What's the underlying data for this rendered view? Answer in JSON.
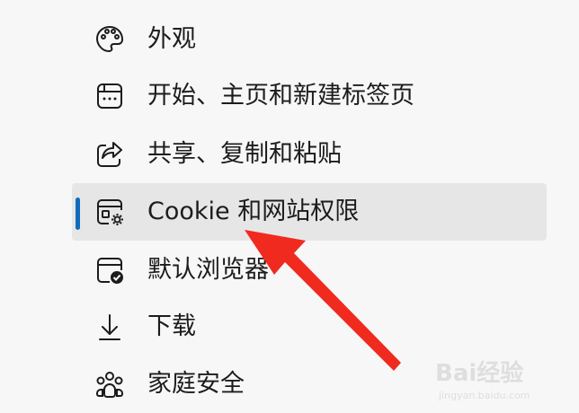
{
  "menu": {
    "items": [
      {
        "label": "外观",
        "icon": "palette-icon"
      },
      {
        "label": "开始、主页和新建标签页",
        "icon": "start-page-icon"
      },
      {
        "label": "共享、复制和粘贴",
        "icon": "share-icon"
      },
      {
        "label": "Cookie 和网站权限",
        "icon": "cookie-site-permissions-icon",
        "active": true
      },
      {
        "label": "默认浏览器",
        "icon": "default-browser-icon"
      },
      {
        "label": "下载",
        "icon": "download-icon"
      },
      {
        "label": "家庭安全",
        "icon": "family-icon"
      }
    ]
  },
  "colors": {
    "accent": "#0f6cbd",
    "active_background": "#e6e6e6",
    "annotation_arrow": "#f02a1f"
  },
  "watermark": {
    "text": "Bai经验",
    "url_text": "jingyan.baidu.com"
  }
}
